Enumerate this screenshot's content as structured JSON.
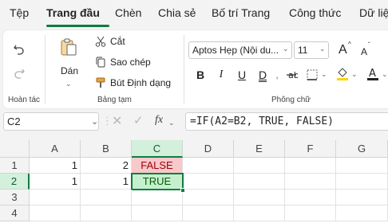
{
  "tabs": [
    "Tệp",
    "Trang đầu",
    "Chèn",
    "Chia sẻ",
    "Bố trí Trang",
    "Công thức",
    "Dữ liệ"
  ],
  "active_tab": "Trang đầu",
  "ribbon": {
    "undo_group_label": "Hoàn tác",
    "paste_label": "Dán",
    "cut_label": "Cắt",
    "copy_label": "Sao chép",
    "format_painter_label": "Bút Định dạng",
    "clipboard_group_label": "Bảng tạm",
    "font_name": "Aptos Hẹp (Nội du...",
    "font_size": "11",
    "font_group_label": "Phông chữ",
    "bold": "B",
    "italic": "I",
    "underline": "U",
    "strikethrough": "D",
    "grow_font": "A",
    "shrink_font": "A",
    "font_color_letter": "A"
  },
  "formula_bar": {
    "name_box": "C2",
    "fx": "fx",
    "formula": "=IF(A2=B2, TRUE, FALSE)"
  },
  "grid": {
    "columns": [
      "A",
      "B",
      "C",
      "D",
      "E",
      "F",
      "G"
    ],
    "rows": [
      "1",
      "2",
      "3",
      "4"
    ],
    "selected_cell": "C2",
    "cells": {
      "A1": "1",
      "B1": "2",
      "C1": "FALSE",
      "A2": "1",
      "B2": "1",
      "C2": "TRUE"
    }
  },
  "colors": {
    "accent": "#107c41",
    "false_fill": "#f8c8cb",
    "false_text": "#9c0006",
    "true_fill": "#c6efce",
    "true_text": "#006100"
  }
}
